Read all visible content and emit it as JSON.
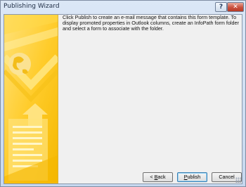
{
  "window": {
    "title": "Publishing Wizard",
    "help_glyph": "?",
    "close_glyph": "✕"
  },
  "content": {
    "description": "Click Publish to create an e-mail message that contains this form template. To display promoted properties in Outlook columns, create an InfoPath form folder and select a form to associate with the folder."
  },
  "buttons": {
    "back_prefix": "< ",
    "back_key": "B",
    "back_rest": "ack",
    "publish_key": "P",
    "publish_rest": "ublish",
    "cancel_label": "Cancel"
  },
  "colors": {
    "banner_light": "#ffe27a",
    "banner_dark": "#f5b800",
    "accent_blue": "#3c7fb1"
  }
}
